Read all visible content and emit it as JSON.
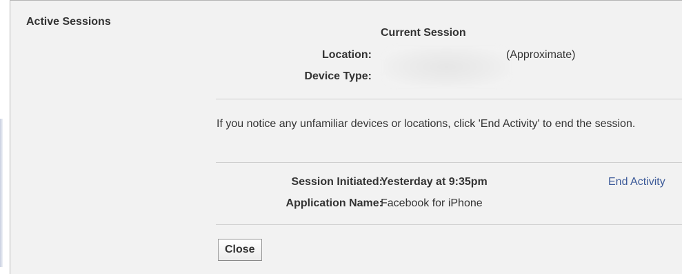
{
  "section": {
    "title": "Active Sessions"
  },
  "current_session": {
    "heading": "Current Session",
    "location_label": "Location:",
    "location_suffix": "(Approximate)",
    "device_type_label": "Device Type:"
  },
  "notice": "If you notice any unfamiliar devices or locations, click 'End Activity' to end the session.",
  "session": {
    "initiated_label": "Session Initiated:",
    "initiated_value": "Yesterday at 9:35pm",
    "app_label": "Application Name:",
    "app_value": "Facebook for iPhone",
    "end_activity_label": "End Activity"
  },
  "actions": {
    "close_label": "Close"
  },
  "colors": {
    "link": "#3b5998",
    "panel_background": "#f2f2f2",
    "divider": "#cfcfcf"
  }
}
